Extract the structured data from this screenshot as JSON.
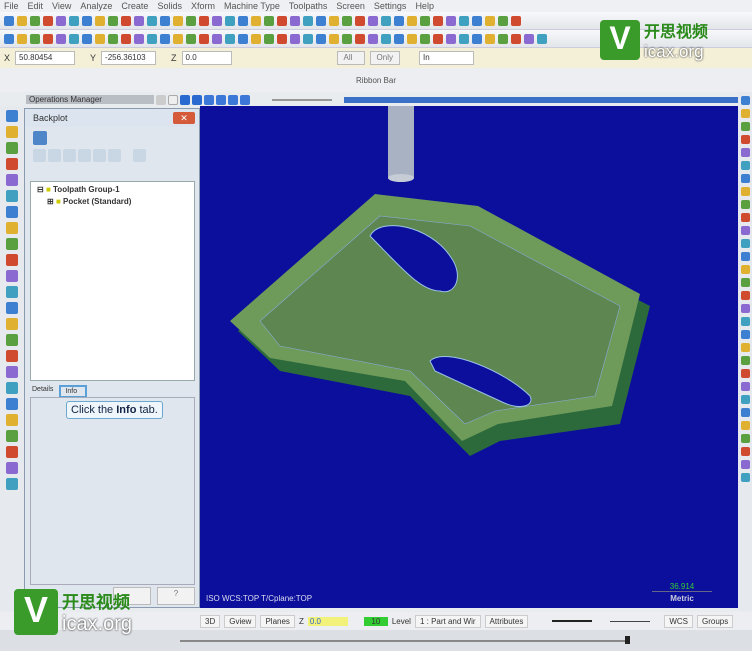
{
  "menu": [
    "File",
    "Edit",
    "View",
    "Analyze",
    "Create",
    "Solids",
    "Xform",
    "Machine Type",
    "Toolpaths",
    "Screen",
    "Settings",
    "Help"
  ],
  "coords": {
    "x_label": "X",
    "x": "50.80454",
    "y_label": "Y",
    "y": "-256.36103",
    "z_label": "Z",
    "z": "0.0",
    "all": "All",
    "only": "Only",
    "units": "In"
  },
  "ribbon": "Ribbon Bar",
  "ops_manager": "Operations Manager",
  "backplot": {
    "title": "Backplot",
    "tree": [
      "Toolpath Group-1",
      "Pocket (Standard)"
    ],
    "tabs": [
      "Details",
      "Info"
    ],
    "tooltip_pre": "Click the ",
    "tooltip_bold": "Info",
    "tooltip_post": " tab."
  },
  "viewport": {
    "view_info": "ISO  WCS:TOP  T/Cplane:TOP",
    "scale": "36.914",
    "units": "Metric"
  },
  "status": {
    "b3d": "3D",
    "gview": "Gview",
    "planes": "Planes",
    "z": "Z",
    "z_val": "0.0",
    "color_val": "10",
    "level": "Level",
    "level_val": "1 : Part and Wir",
    "attributes": "Attributes",
    "wcs": "WCS",
    "groups": "Groups"
  },
  "watermark": {
    "cn": "开思视频",
    "url": "icax.org"
  }
}
